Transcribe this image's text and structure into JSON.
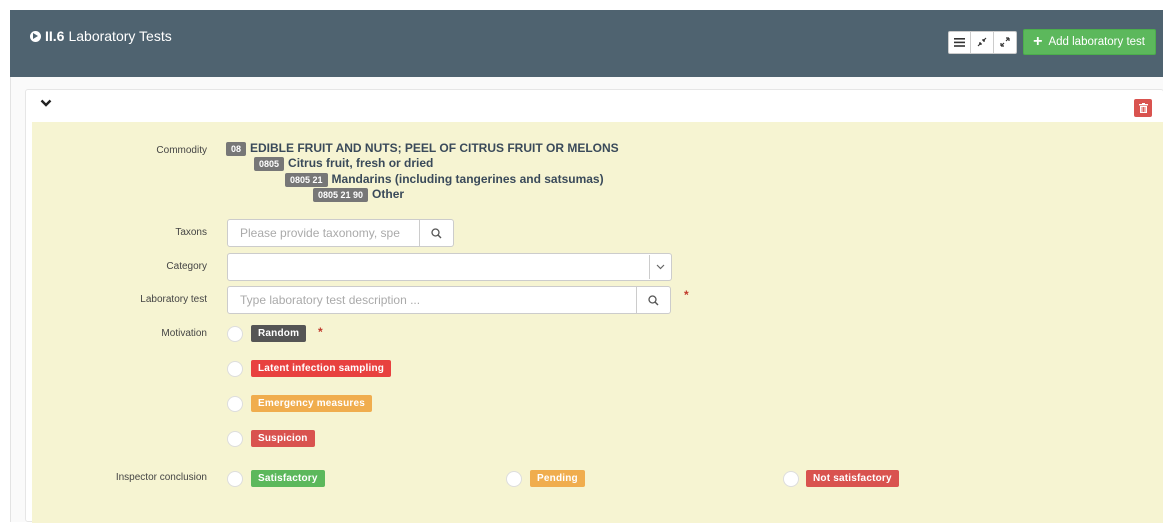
{
  "panel": {
    "section_code": "II.6",
    "title": "Laboratory Tests",
    "add_label": "Add laboratory test"
  },
  "icons": {
    "header_arrow": "circle-arrow-right-icon",
    "list": "list-icon",
    "compress": "compress-icon",
    "expand": "expand-icon",
    "add": "plus-icon",
    "collapse": "chevron-down-icon",
    "delete": "trash-icon",
    "search": "search-icon",
    "dropdown": "chevron-down-icon"
  },
  "colors": {
    "header_bg": "#4f6370",
    "body_bg": "#f6f4d2",
    "add_button": "#5cb85c",
    "delete_button": "#d9534f"
  },
  "form": {
    "commodity": {
      "label": "Commodity",
      "lines": [
        {
          "code": "08",
          "text": "EDIBLE FRUIT AND NUTS; PEEL OF CITRUS FRUIT OR MELONS"
        },
        {
          "code": "0805",
          "text": "Citrus fruit, fresh or dried"
        },
        {
          "code": "0805 21",
          "text": "Mandarins (including tangerines and satsumas)"
        },
        {
          "code": "0805 21 90",
          "text": "Other"
        }
      ]
    },
    "taxons": {
      "label": "Taxons",
      "placeholder": "Please provide taxonomy, spe",
      "value": ""
    },
    "category": {
      "label": "Category",
      "value": ""
    },
    "laboratory_test": {
      "label": "Laboratory test",
      "placeholder": "Type laboratory test description ...",
      "value": "",
      "required_mark": "*"
    },
    "motivation": {
      "label": "Motivation",
      "required_mark": "*",
      "options": [
        {
          "label": "Random",
          "color": "#555555"
        },
        {
          "label": "Latent infection sampling",
          "color": "#e8413f"
        },
        {
          "label": "Emergency measures",
          "color": "#f0ad4e"
        },
        {
          "label": "Suspicion",
          "color": "#d9534f"
        }
      ]
    },
    "inspector_conclusion": {
      "label": "Inspector conclusion",
      "options": [
        {
          "label": "Satisfactory",
          "color": "#5cb85c"
        },
        {
          "label": "Pending",
          "color": "#f0ad4e"
        },
        {
          "label": "Not satisfactory",
          "color": "#d9534f"
        }
      ]
    }
  }
}
